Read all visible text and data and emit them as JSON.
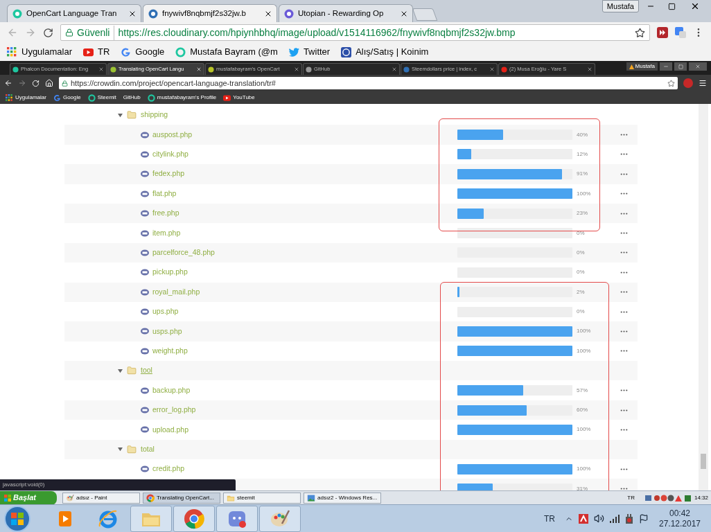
{
  "browser": {
    "tabs": [
      {
        "title": "OpenCart Language Tran",
        "selected": false
      },
      {
        "title": "fnywivf8nqbmjf2s32jw.b",
        "selected": true
      },
      {
        "title": "Utopian - Rewarding Op",
        "selected": false
      }
    ],
    "profile": "Mustafa",
    "secure_label": "Güvenli",
    "url": "https://res.cloudinary.com/hpiynhbhq/image/upload/v1514116962/fnywivf8nqbmjf2s32jw.bmp",
    "bookmarks": [
      {
        "label": "Uygulamalar",
        "kind": "apps"
      },
      {
        "label": "TR",
        "kind": "video"
      },
      {
        "label": "Google",
        "kind": "google"
      },
      {
        "label": "Mustafa Bayram (@m",
        "kind": "ring"
      },
      {
        "label": "Twitter",
        "kind": "bird"
      },
      {
        "label": "Alış/Satış | Koinim",
        "kind": "coin"
      }
    ]
  },
  "image": {
    "browser": {
      "tabs": [
        {
          "title": "Phalcon Documentation: Eng",
          "selected": false
        },
        {
          "title": "Translating OpenCart Langu",
          "selected": true
        },
        {
          "title": "mustafabayram's OpenCart",
          "selected": false
        },
        {
          "title": "GitHub",
          "selected": false
        },
        {
          "title": "Steemdollars price | index, c",
          "selected": false
        },
        {
          "title": "(2) Musa Eroğlu - Yare S",
          "selected": false
        }
      ],
      "profile": "Mustafa",
      "url": "https://crowdin.com/project/opencart-language-translation/tr#",
      "bookmarks": [
        {
          "label": "Uygulamalar",
          "kind": "apps"
        },
        {
          "label": "Google",
          "kind": "google"
        },
        {
          "label": "Steemit",
          "kind": "ring"
        },
        {
          "label": "GitHub",
          "kind": "none"
        },
        {
          "label": "mustafabayram's Profile",
          "kind": "ring"
        },
        {
          "label": "YouTube",
          "kind": "video"
        }
      ]
    },
    "tree": [
      {
        "kind": "folder",
        "name": "shipping",
        "expanded": true,
        "hovered": false,
        "children": [
          {
            "kind": "file",
            "name": "auspost.php",
            "level": 0.4,
            "reading": "40%"
          },
          {
            "kind": "file",
            "name": "citylink.php",
            "level": 0.12,
            "reading": "12%"
          },
          {
            "kind": "file",
            "name": "fedex.php",
            "level": 0.91,
            "reading": "91%"
          },
          {
            "kind": "file",
            "name": "flat.php",
            "level": 1,
            "reading": "100%"
          },
          {
            "kind": "file",
            "name": "free.php",
            "level": 0.23,
            "reading": "23%"
          },
          {
            "kind": "file",
            "name": "item.php",
            "level": 0,
            "reading": "0%"
          },
          {
            "kind": "file",
            "name": "parcelforce_48.php",
            "level": 0,
            "reading": "0%"
          },
          {
            "kind": "file",
            "name": "pickup.php",
            "level": 0,
            "reading": "0%"
          },
          {
            "kind": "file",
            "name": "royal_mail.php",
            "level": 0.02,
            "reading": "2%"
          },
          {
            "kind": "file",
            "name": "ups.php",
            "level": 0,
            "reading": "0%"
          },
          {
            "kind": "file",
            "name": "usps.php",
            "level": 1,
            "reading": "100%"
          },
          {
            "kind": "file",
            "name": "weight.php",
            "level": 1,
            "reading": "100%"
          }
        ]
      },
      {
        "kind": "folder",
        "name": "tool",
        "expanded": true,
        "hovered": true,
        "children": [
          {
            "kind": "file",
            "name": "backup.php",
            "level": 0.57,
            "reading": "57%"
          },
          {
            "kind": "file",
            "name": "error_log.php",
            "level": 0.6,
            "reading": "60%"
          },
          {
            "kind": "file",
            "name": "upload.php",
            "level": 1,
            "reading": "100%"
          }
        ]
      },
      {
        "kind": "folder",
        "name": "total",
        "expanded": true,
        "hovered": false,
        "children": [
          {
            "kind": "file",
            "name": "credit.php",
            "level": 1,
            "reading": "100%"
          },
          {
            "kind": "file",
            "level": 0.31,
            "reading": "31%"
          }
        ]
      }
    ],
    "status_text": "javascript:void(0)",
    "taskbar": {
      "start": "Başlat",
      "tasks": [
        {
          "label": "adsız - Paint",
          "kind": "paint",
          "selected": false
        },
        {
          "label": "Translating OpenCart...",
          "kind": "chrome",
          "selected": true
        },
        {
          "label": "steemit",
          "kind": "folder",
          "selected": false
        },
        {
          "label": "adsız2 - Windows Res...",
          "kind": "photo",
          "selected": false
        }
      ],
      "language": "TR",
      "time": "14:32"
    }
  },
  "taskbar": {
    "apps": [
      {
        "kind": "media",
        "selected": false
      },
      {
        "kind": "ie",
        "selected": false
      },
      {
        "kind": "explorer",
        "selected": true
      },
      {
        "kind": "chrome",
        "selected": true
      },
      {
        "kind": "discord",
        "selected": true
      },
      {
        "kind": "paint",
        "selected": true
      }
    ],
    "language": "TR",
    "time": "00:42",
    "date": "27.12.2017"
  }
}
